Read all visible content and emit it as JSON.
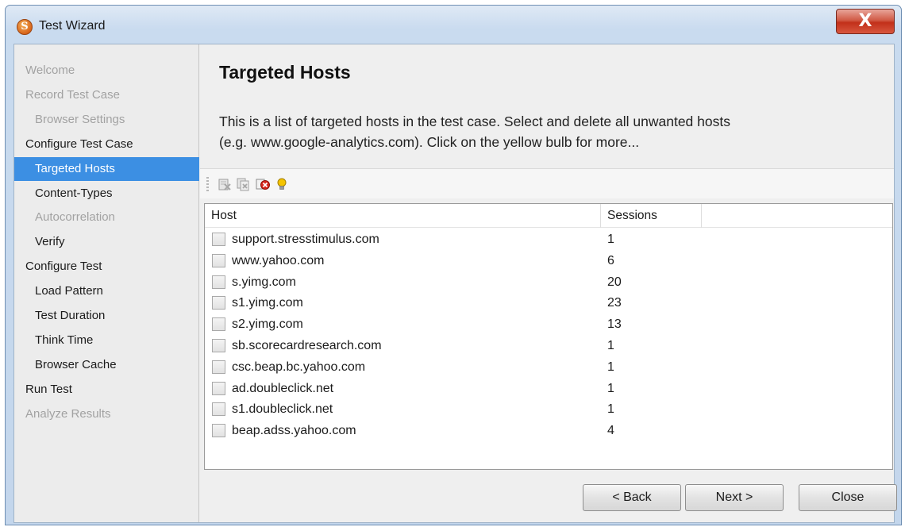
{
  "window": {
    "title": "Test Wizard",
    "app_icon_letter": "S",
    "close_glyph": "X"
  },
  "sidebar": {
    "items": [
      {
        "label": "Welcome",
        "level": 0,
        "state": "disabled"
      },
      {
        "label": "Record Test Case",
        "level": 0,
        "state": "disabled"
      },
      {
        "label": "Browser Settings",
        "level": 1,
        "state": "disabled"
      },
      {
        "label": "Configure Test Case",
        "level": 0,
        "state": "normal"
      },
      {
        "label": "Targeted Hosts",
        "level": 1,
        "state": "selected"
      },
      {
        "label": "Content-Types",
        "level": 1,
        "state": "normal"
      },
      {
        "label": "Autocorrelation",
        "level": 1,
        "state": "disabled"
      },
      {
        "label": "Verify",
        "level": 1,
        "state": "normal"
      },
      {
        "label": "Configure Test",
        "level": 0,
        "state": "normal"
      },
      {
        "label": "Load Pattern",
        "level": 1,
        "state": "normal"
      },
      {
        "label": "Test Duration",
        "level": 1,
        "state": "normal"
      },
      {
        "label": "Think Time",
        "level": 1,
        "state": "normal"
      },
      {
        "label": "Browser Cache",
        "level": 1,
        "state": "normal"
      },
      {
        "label": "Run Test",
        "level": 0,
        "state": "normal"
      },
      {
        "label": "Analyze Results",
        "level": 0,
        "state": "disabled"
      }
    ]
  },
  "main": {
    "title": "Targeted Hosts",
    "description_line1": "This is a list of targeted hosts in the test case. Select and delete all unwanted hosts",
    "description_line2": "(e.g. www.google-analytics.com). Click on the yellow bulb for more...",
    "toolbar": {
      "icons": [
        "delete-selected-icon",
        "delete-all-icon",
        "delete-unchecked-icon",
        "lightbulb-help-icon"
      ]
    },
    "table": {
      "columns": [
        "Host",
        "Sessions"
      ],
      "rows": [
        {
          "host": "support.stresstimulus.com",
          "sessions": "1",
          "checked": false
        },
        {
          "host": "www.yahoo.com",
          "sessions": "6",
          "checked": false
        },
        {
          "host": "s.yimg.com",
          "sessions": "20",
          "checked": false
        },
        {
          "host": "s1.yimg.com",
          "sessions": "23",
          "checked": false
        },
        {
          "host": "s2.yimg.com",
          "sessions": "13",
          "checked": false
        },
        {
          "host": "sb.scorecardresearch.com",
          "sessions": "1",
          "checked": false
        },
        {
          "host": "csc.beap.bc.yahoo.com",
          "sessions": "1",
          "checked": false
        },
        {
          "host": "ad.doubleclick.net",
          "sessions": "1",
          "checked": false
        },
        {
          "host": "s1.doubleclick.net",
          "sessions": "1",
          "checked": false
        },
        {
          "host": "beap.adss.yahoo.com",
          "sessions": "4",
          "checked": false
        }
      ]
    }
  },
  "buttons": {
    "back": "< Back",
    "next": "Next >",
    "close": "Close"
  },
  "colors": {
    "selection": "#3c8fe3",
    "bulb": "#f5c400"
  }
}
